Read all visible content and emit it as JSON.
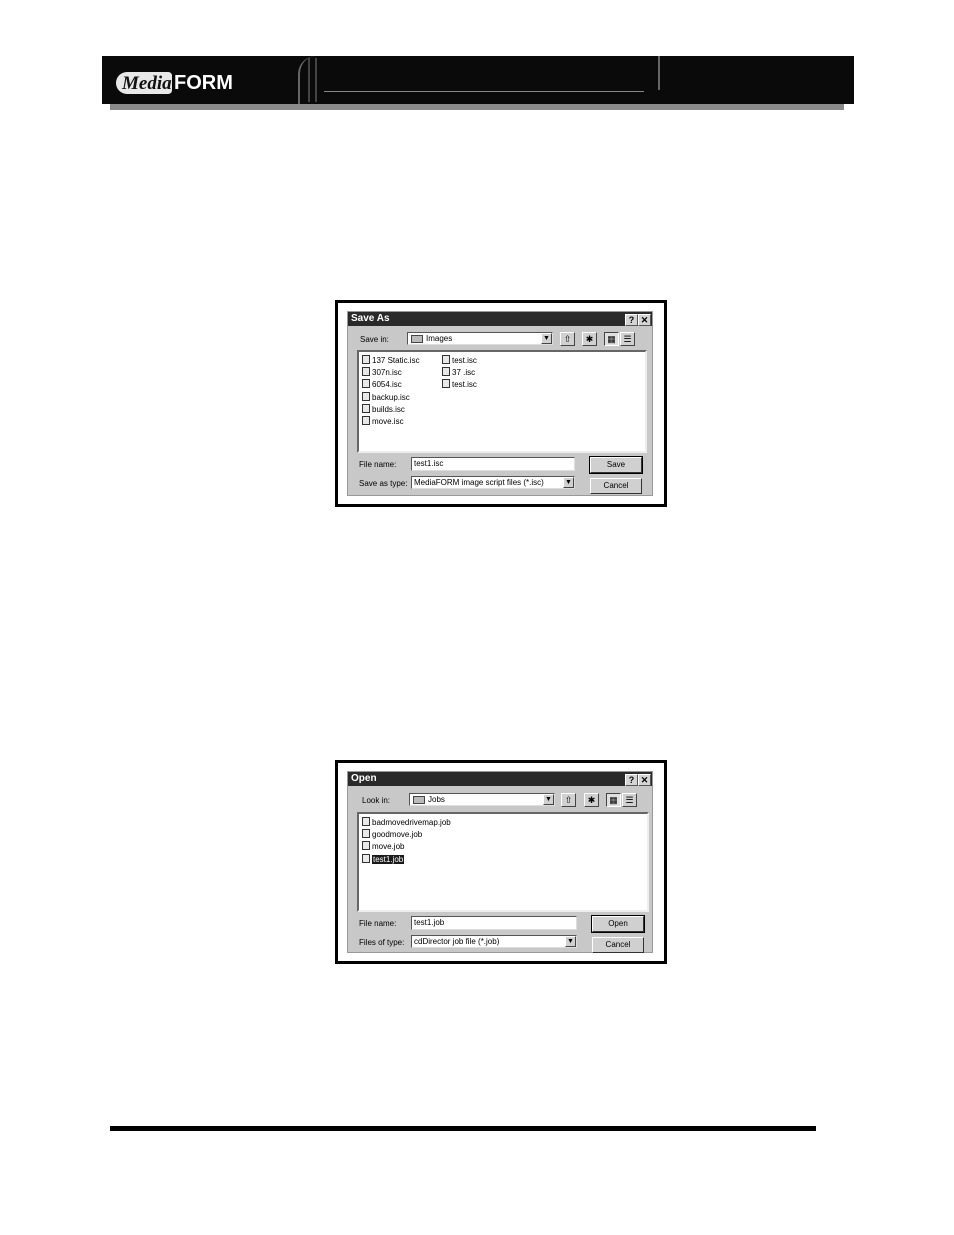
{
  "brand": {
    "logo_media": "Media",
    "logo_form": "FORM"
  },
  "save_dialog": {
    "title": "Save As",
    "help_btn": "?",
    "close_btn": "✕",
    "location_label": "Save in:",
    "location_value": "Images",
    "files": [
      "137 Static.isc",
      "307n.isc",
      "6054.isc",
      "backup.isc",
      "builds.isc",
      "move.isc",
      "test.isc",
      "37 .isc",
      "test.isc"
    ],
    "filename_label": "File name:",
    "filename_value": "test1.isc",
    "type_label": "Save as type:",
    "type_value": "MediaFORM image script files (*.isc)",
    "primary_button": "Save",
    "cancel_button": "Cancel"
  },
  "open_dialog": {
    "title": "Open",
    "help_btn": "?",
    "close_btn": "✕",
    "location_label": "Look in:",
    "location_value": "Jobs",
    "files": [
      "badmovedrivemap.job",
      "goodmove.job",
      "move.job",
      "test1.job"
    ],
    "selected_file": "test1.job",
    "filename_label": "File name:",
    "filename_value": "test1.job",
    "type_label": "Files of type:",
    "type_value": "cdDirector job file (*.job)",
    "primary_button": "Open",
    "cancel_button": "Cancel"
  },
  "icons": {
    "folder": "folder-icon",
    "up_folder": "up-folder-icon",
    "new_folder": "new-folder-icon",
    "list_view": "list-view-icon",
    "details_view": "details-view-icon",
    "dropdown": "chevron-down-icon",
    "file": "file-icon"
  }
}
